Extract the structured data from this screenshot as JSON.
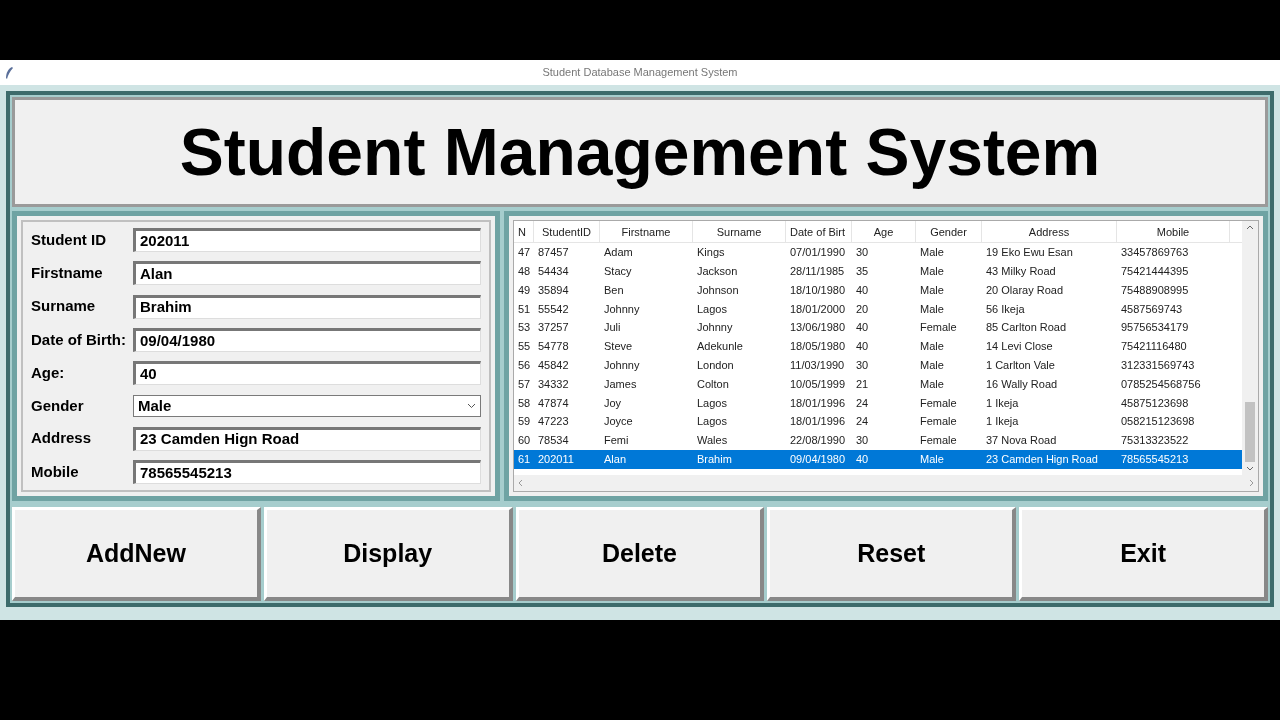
{
  "window": {
    "title": "Student Database Management System"
  },
  "heading": "Student Management System",
  "form": [
    {
      "label": "Student ID",
      "kind": "entry",
      "value": "202011"
    },
    {
      "label": "Firstname",
      "kind": "entry",
      "value": "Alan"
    },
    {
      "label": "Surname",
      "kind": "entry",
      "value": "Brahim"
    },
    {
      "label": "Date of Birth:",
      "kind": "entry",
      "value": "09/04/1980"
    },
    {
      "label": "Age:",
      "kind": "entry",
      "value": "40"
    },
    {
      "label": "Gender",
      "kind": "combo",
      "value": "Male"
    },
    {
      "label": "Address",
      "kind": "entry",
      "value": "23 Camden Hign Road"
    },
    {
      "label": "Mobile",
      "kind": "entry",
      "value": "78565545213"
    }
  ],
  "table": {
    "columns": [
      "N",
      "StudentID",
      "Firstname",
      "Surname",
      "Date of Birt",
      "Age",
      "Gender",
      "Address",
      "Mobile"
    ],
    "rows": [
      {
        "selected": false,
        "cells": [
          "47",
          "87457",
          "Adam",
          "Kings",
          "07/01/1990",
          "30",
          "Male",
          "19 Eko Ewu Esan",
          "33457869763"
        ]
      },
      {
        "selected": false,
        "cells": [
          "48",
          "54434",
          "Stacy",
          "Jackson",
          "28/11/1985",
          "35",
          "Male",
          "43 Milky Road",
          "75421444395"
        ]
      },
      {
        "selected": false,
        "cells": [
          "49",
          "35894",
          "Ben",
          "Johnson",
          "18/10/1980",
          "40",
          "Male",
          "20 Olaray Road",
          "75488908995"
        ]
      },
      {
        "selected": false,
        "cells": [
          "51",
          "55542",
          "Johnny",
          "Lagos",
          "18/01/2000",
          "20",
          "Male",
          "56 Ikeja",
          "4587569743"
        ]
      },
      {
        "selected": false,
        "cells": [
          "53",
          "37257",
          "Juli",
          "Johnny",
          "13/06/1980",
          "40",
          "Female",
          "85 Carlton Road",
          "95756534179"
        ]
      },
      {
        "selected": false,
        "cells": [
          "55",
          "54778",
          "Steve",
          "Adekunle",
          "18/05/1980",
          "40",
          "Male",
          "14 Levi Close",
          "75421116480"
        ]
      },
      {
        "selected": false,
        "cells": [
          "56",
          "45842",
          "Johnny",
          "London",
          "11/03/1990",
          "30",
          "Male",
          "1 Carlton Vale",
          "312331569743"
        ]
      },
      {
        "selected": false,
        "cells": [
          "57",
          "34332",
          "James",
          "Colton",
          "10/05/1999",
          "21",
          "Male",
          "16 Wally Road",
          "0785254568756"
        ]
      },
      {
        "selected": false,
        "cells": [
          "58",
          "47874",
          "Joy",
          "Lagos",
          "18/01/1996",
          "24",
          "Female",
          "1 Ikeja",
          "45875123698"
        ]
      },
      {
        "selected": false,
        "cells": [
          "59",
          "47223",
          "Joyce",
          "Lagos",
          "18/01/1996",
          "24",
          "Female",
          "1 Ikeja",
          "058215123698"
        ]
      },
      {
        "selected": false,
        "cells": [
          "60",
          "78534",
          "Femi",
          "Wales",
          "22/08/1990",
          "30",
          "Female",
          "37 Nova Road",
          "75313323522"
        ]
      },
      {
        "selected": true,
        "cells": [
          "61",
          "202011",
          "Alan",
          "Brahim",
          "09/04/1980",
          "40",
          "Male",
          "23 Camden Hign Road",
          "78565545213"
        ]
      }
    ]
  },
  "buttons": [
    "AddNew",
    "Display",
    "Delete",
    "Reset",
    "Exit"
  ]
}
